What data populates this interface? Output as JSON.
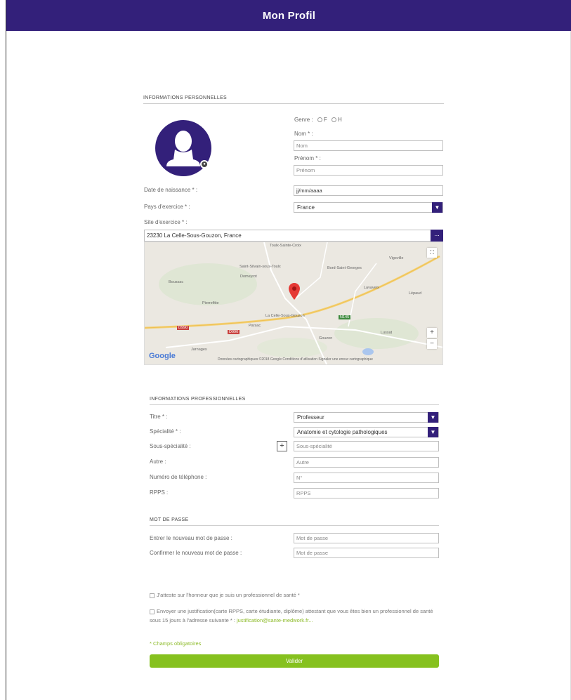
{
  "header": {
    "title": "Mon Profil"
  },
  "personal": {
    "section_title": "INFORMATIONS PERSONNELLES",
    "gender_label": "Genre :",
    "gender_f": "F",
    "gender_h": "H",
    "nom_label": "Nom * :",
    "nom_placeholder": "Nom",
    "prenom_label": "Prénom * :",
    "prenom_placeholder": "Prénom",
    "birth_label": "Date de naissance * :",
    "birth_value": "jj/mm/aaaa",
    "country_label": "Pays d'exercice * :",
    "country_value": "France",
    "site_label": "Site d'exercice * :",
    "address_value": "23230 La Celle-Sous-Gouzon, France",
    "address_button": "...",
    "map": {
      "places": [
        "Toulx-Sainte-Croix",
        "Saint-Silvain-sous-Toulx",
        "Domeyrot",
        "Boussac",
        "Bord-Saint-Georges",
        "Lavaveix",
        "Lussat",
        "Parsac",
        "La Celle-Sous-Gouzon",
        "Pierrefitte",
        "Gouzon",
        "Jarnages",
        "Lépaud",
        "Vigeville"
      ],
      "roads": [
        "D990",
        "D990",
        "N145"
      ],
      "attribution": "Données cartographiques ©2018 Google   Conditions d'utilisation   Signaler une erreur cartographique",
      "logo": "Google",
      "zoom_in": "+",
      "zoom_out": "−",
      "fullscreen": "⛶"
    }
  },
  "professional": {
    "section_title": "INFORMATIONS PROFESSIONNELLES",
    "title_label": "Titre * :",
    "title_value": "Professeur",
    "specialty_label": "Spécialité * :",
    "specialty_value": "Anatomie et cytologie pathologiques",
    "subspecialty_label": "Sous-spécialité :",
    "subspecialty_placeholder": "Sous-spécialité",
    "add_button": "+",
    "other_label": "Autre :",
    "other_placeholder": "Autre",
    "phone_label": "Numéro de téléphone :",
    "phone_placeholder": "N°",
    "rpps_label": "RPPS :",
    "rpps_placeholder": "RPPS"
  },
  "password": {
    "section_title": "MOT DE PASSE",
    "new_label": "Entrer le nouveau mot de passe :",
    "new_placeholder": "Mot de passe",
    "confirm_label": "Confirmer le nouveau mot de passe :",
    "confirm_placeholder": "Mot de passe"
  },
  "consent": {
    "attest_text": "J'atteste sur l'honneur que je suis un professionnel de santé *",
    "justif_text": "Envoyer une justification(carte RPPS, carte étudiante, diplôme) attestant que vous êtes bien un professionnel de santé sous 15 jours à l'adresse suivante * :",
    "justif_email": "justification@sante-medwork.fr..."
  },
  "footer": {
    "required_note": "* Champs obligatoires",
    "submit_label": "Valider"
  },
  "colors": {
    "primary": "#33207a",
    "accent_green": "#86c11f"
  }
}
